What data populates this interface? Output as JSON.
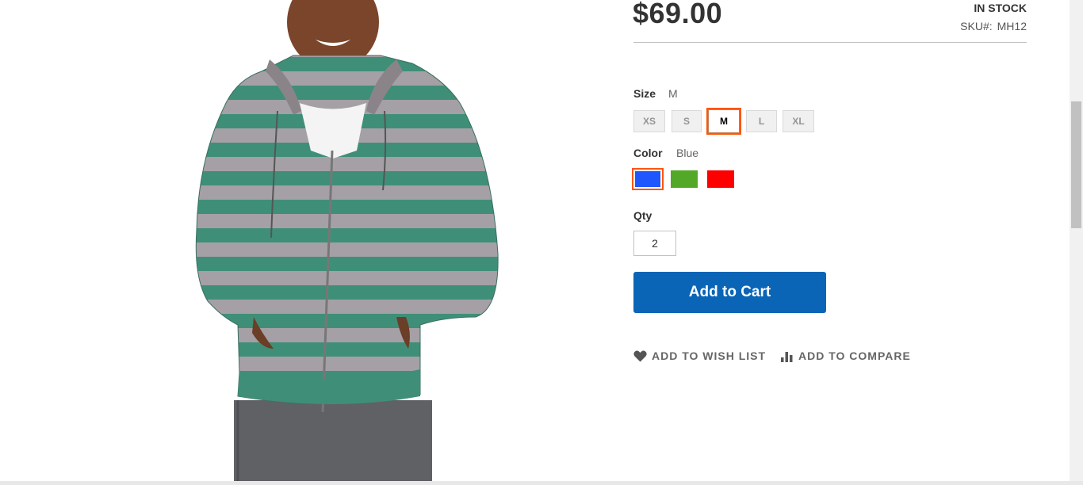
{
  "product": {
    "price": "$69.00",
    "stock": "IN STOCK",
    "sku_label": "SKU#:",
    "sku": "MH12",
    "image_alt": "Striped green and grey zip hoodie worn by a model"
  },
  "options": {
    "size": {
      "label": "Size",
      "selected": "M",
      "values": [
        "XS",
        "S",
        "M",
        "L",
        "XL"
      ]
    },
    "color": {
      "label": "Color",
      "selected": "Blue",
      "swatches": [
        {
          "name": "Blue",
          "hex": "#1f57ff"
        },
        {
          "name": "Green",
          "hex": "#53a828"
        },
        {
          "name": "Red",
          "hex": "#ff0000"
        }
      ]
    }
  },
  "qty": {
    "label": "Qty",
    "value": "2"
  },
  "actions": {
    "add_to_cart": "Add to Cart",
    "wish_list": "ADD TO WISH LIST",
    "compare": "ADD TO COMPARE"
  },
  "theme": {
    "accent_border": "#ff5501",
    "button_blue": "#0b65b7"
  }
}
